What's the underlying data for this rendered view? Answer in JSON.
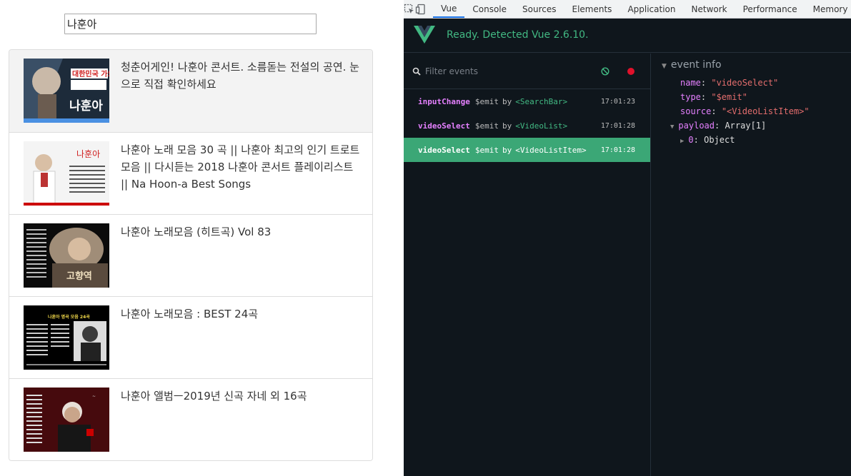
{
  "search": {
    "value": "나훈아"
  },
  "videos": [
    {
      "title": "청춘어게인! 나훈아 콘서트. 소름돋는 전설의 공연. 눈으로 직접 확인하세요",
      "thumb_text": "나훈아",
      "thumb_caption": "대한민국 가요계 황제"
    },
    {
      "title": "나훈아 노래 모음 30 곡 || 나훈아 최고의 인기 트로트 모음 || 다시듣는 2018 나훈아 콘서트 플레이리스트 || Na Hoon-a Best Songs",
      "thumb_text": "나훈아"
    },
    {
      "title": "나훈아 노래모음 (히트곡) Vol 83",
      "thumb_text": "고향역"
    },
    {
      "title": "나훈아 노래모음 : BEST 24곡",
      "thumb_text": "나훈아 명곡 모음 24곡"
    },
    {
      "title": "나훈아 앨범ㅡ2019년 신곡 자네 외 16곡",
      "thumb_text": ""
    }
  ],
  "devtools": {
    "tabs": [
      "Vue",
      "Console",
      "Sources",
      "Elements",
      "Application",
      "Network",
      "Performance",
      "Memory"
    ],
    "status": "Ready. Detected Vue 2.6.10.",
    "filter_placeholder": "Filter events",
    "events": [
      {
        "name": "inputChange",
        "type": "$emit",
        "by": "by",
        "source": "<SearchBar>",
        "time": "17:01:23"
      },
      {
        "name": "videoSelect",
        "type": "$emit",
        "by": "by",
        "source": "<VideoList>",
        "time": "17:01:28"
      },
      {
        "name": "videoSelect",
        "type": "$emit",
        "by": "by",
        "source": "<VideoListItem>",
        "time": "17:01:28"
      }
    ],
    "info": {
      "heading": "event info",
      "name_key": "name",
      "name_val": "\"videoSelect\"",
      "type_key": "type",
      "type_val": "\"$emit\"",
      "source_key": "source",
      "source_val": "\"<VideoListItem>\"",
      "payload_key": "payload",
      "payload_val": "Array[1]",
      "item_key": "0",
      "item_val": "Object"
    },
    "colors": {
      "accent": "#42b983",
      "selected": "#3ba776",
      "record": "#e0112b"
    }
  }
}
